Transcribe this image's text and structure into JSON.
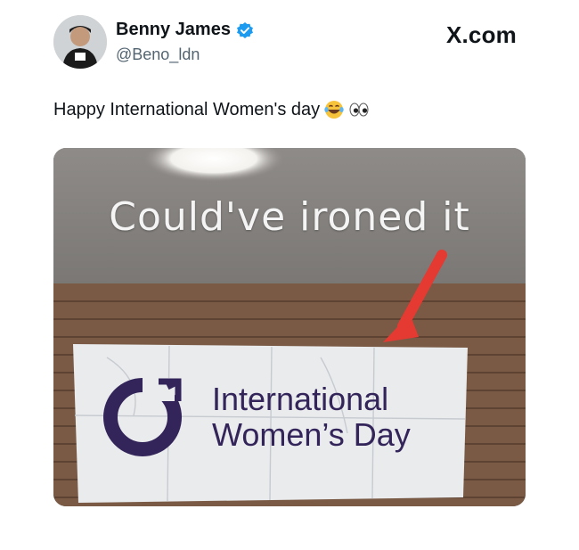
{
  "post": {
    "author_name": "Benny James",
    "author_handle": "@Beno_ldn",
    "brand": "X.com",
    "text": "Happy International Women's day",
    "emojis": [
      "face-with-tears-of-joy",
      "eyes"
    ]
  },
  "image": {
    "caption": "Could've ironed it",
    "banner_line1": "International",
    "banner_line2": "Women’s Day"
  },
  "colors": {
    "verified": "#1d9bf0",
    "arrow": "#e53a32",
    "banner_logo": "#33245a"
  }
}
